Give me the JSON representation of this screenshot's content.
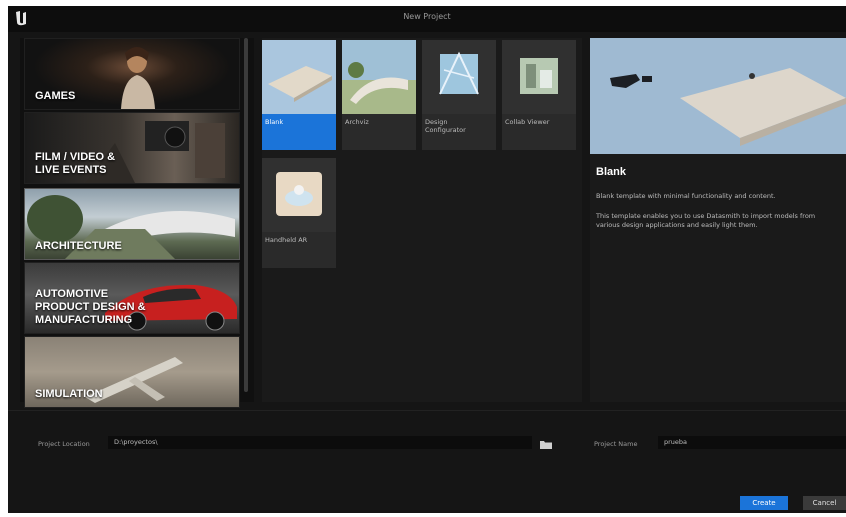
{
  "window": {
    "title": "New Project"
  },
  "categories": [
    {
      "label": "GAMES"
    },
    {
      "label": "FILM / VIDEO &\nLIVE EVENTS"
    },
    {
      "label": "ARCHITECTURE"
    },
    {
      "label": "AUTOMOTIVE\nPRODUCT DESIGN &\nMANUFACTURING"
    },
    {
      "label": "SIMULATION"
    }
  ],
  "templates": [
    {
      "name": "Blank",
      "selected": true
    },
    {
      "name": "Archviz",
      "selected": false
    },
    {
      "name": "Design\nConfigurator",
      "selected": false
    },
    {
      "name": "Collab Viewer",
      "selected": false
    },
    {
      "name": "Handheld AR",
      "selected": false
    }
  ],
  "description": {
    "title": "Blank",
    "line1": "Blank template with minimal functionality and content.",
    "line2": "This template enables you to use Datasmith to import models from various design applications and easily light them."
  },
  "project": {
    "location_label": "Project Location",
    "location_value": "D:\\proyectos\\",
    "name_label": "Project Name",
    "name_value": "prueba"
  },
  "buttons": {
    "create": "Create",
    "cancel": "Cancel"
  },
  "colors": {
    "accent": "#1b74d9",
    "background": "#151515"
  }
}
